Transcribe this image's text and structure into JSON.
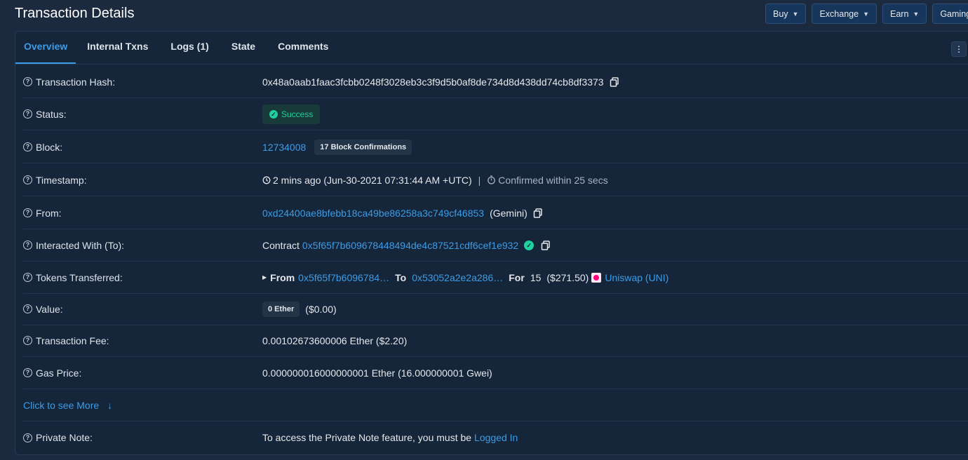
{
  "header": {
    "title": "Transaction Details"
  },
  "menu": [
    {
      "label": "Buy"
    },
    {
      "label": "Exchange"
    },
    {
      "label": "Earn"
    },
    {
      "label": "Gaming"
    }
  ],
  "tabs": [
    {
      "label": "Overview"
    },
    {
      "label": "Internal Txns"
    },
    {
      "label": "Logs (1)"
    },
    {
      "label": "State"
    },
    {
      "label": "Comments"
    }
  ],
  "rows": {
    "hash": {
      "label": "Transaction Hash:",
      "value": "0x48a0aab1faac3fcbb0248f3028eb3c3f9d5b0af8de734d8d438dd74cb8df3373"
    },
    "status": {
      "label": "Status:",
      "value": "Success"
    },
    "block": {
      "label": "Block:",
      "value": "12734008",
      "confirmations": "17 Block Confirmations"
    },
    "timestamp": {
      "label": "Timestamp:",
      "value": "2 mins ago (Jun-30-2021 07:31:44 AM +UTC)",
      "separator": "|",
      "confirmed": "Confirmed within 25 secs"
    },
    "from": {
      "label": "From:",
      "address": "0xd24400ae8bfebb18ca49be86258a3c749cf46853",
      "name": "(Gemini)"
    },
    "to": {
      "label": "Interacted With (To):",
      "prefix": "Contract",
      "address": "0x5f65f7b609678448494de4c87521cdf6cef1e932"
    },
    "tokens": {
      "label": "Tokens Transferred:",
      "from_label": "From",
      "from_addr": "0x5f65f7b6096784…",
      "to_label": "To",
      "to_addr": "0x53052a2e2a286…",
      "for_label": "For",
      "amount": "15",
      "usd": "($271.50)",
      "token": "Uniswap (UNI)"
    },
    "value": {
      "label": "Value:",
      "ether": "0 Ether",
      "usd": "($0.00)"
    },
    "fee": {
      "label": "Transaction Fee:",
      "value": "0.00102673600006 Ether ($2.20)"
    },
    "gas": {
      "label": "Gas Price:",
      "value": "0.000000016000000001 Ether (16.000000001 Gwei)"
    },
    "more": {
      "label": "Click to see More",
      "arrow": "↓"
    },
    "note": {
      "label": "Private Note:",
      "text": "To access the Private Note feature, you must be",
      "link": "Logged In"
    }
  }
}
